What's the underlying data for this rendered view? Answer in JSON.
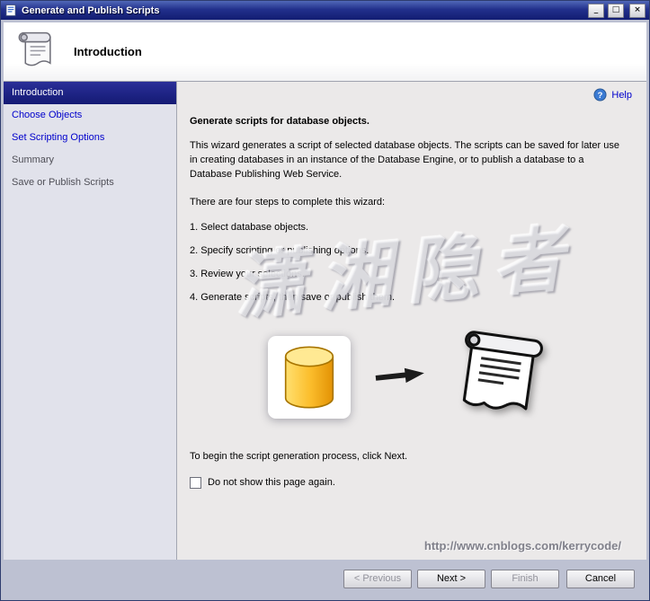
{
  "window": {
    "title": "Generate and Publish Scripts",
    "controls": {
      "minimize": "_",
      "maximize": "□",
      "close": "×"
    }
  },
  "header": {
    "title": "Introduction"
  },
  "sidebar": {
    "items": [
      {
        "label": "Introduction",
        "state": "active"
      },
      {
        "label": "Choose Objects",
        "state": "link"
      },
      {
        "label": "Set Scripting Options",
        "state": "link"
      },
      {
        "label": "Summary",
        "state": "disabled"
      },
      {
        "label": "Save or Publish Scripts",
        "state": "disabled"
      }
    ]
  },
  "content": {
    "help_label": "Help",
    "heading": "Generate scripts for database objects.",
    "intro": "This wizard generates a script of selected database objects. The scripts can be saved for later use in creating databases in an instance of the Database Engine, or to publish a database to a Database Publishing Web Service.",
    "steps_intro": "There are four steps to complete this wizard:",
    "steps": [
      "1. Select database objects.",
      "2. Specify scripting or publishing options.",
      "3. Review your selections.",
      "4. Generate scripts, then save or publish them."
    ],
    "closing": "To begin the script generation process, click Next.",
    "checkbox_label": "Do not show this page again.",
    "watermark_cjk": "潇湘隐者",
    "watermark_url": "http://www.cnblogs.com/kerrycode/"
  },
  "footer": {
    "previous": "< Previous",
    "next": "Next >",
    "finish": "Finish",
    "cancel": "Cancel"
  },
  "colors": {
    "titlebar_blue": "#1c2a84",
    "selected_item": "#171c7c",
    "link_blue": "#0000cc",
    "database_yellow": "#fcbf2e"
  }
}
